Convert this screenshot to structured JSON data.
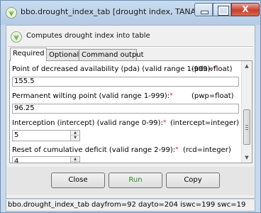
{
  "window": {
    "title": "bbo.drought_index_tab [drought index, TANA...",
    "close_glyph": "X"
  },
  "description": "Computes drought index into table",
  "tabs": [
    {
      "label": "Required",
      "active": true
    },
    {
      "label": "Optional",
      "active": false
    },
    {
      "label": "Command output",
      "active": false
    }
  ],
  "fields": {
    "pda": {
      "label": "Point of decreased availability (pda) (valid range 1-999):",
      "required_mark": "*",
      "type": "(pda=float)",
      "value": "155.5"
    },
    "pwp": {
      "label": "Permanent wilting point (valid range 1-999):",
      "required_mark": "*",
      "type": "(pwp=float)",
      "value": "96.25"
    },
    "intercept": {
      "label": "Interception (intercept) (valid range 0-99):",
      "required_mark": "*",
      "type": "(intercept=integer)",
      "value": "5"
    },
    "rcd": {
      "label": "Reset of cumulative deficit (valid range 2-99):",
      "required_mark": "*",
      "type": "(rcd=integer)",
      "value": "4"
    }
  },
  "buttons": {
    "close": "Close",
    "run": "Run",
    "copy": "Copy"
  },
  "statusbar": "bbo.drought_index_tab dayfrom=92 dayto=204 iswc=199 swc=19",
  "colors": {
    "required_mark": "#e02020",
    "run_text": "#2e8b2e",
    "title_bar": "#b4cbe4",
    "close_button": "#c7402f"
  }
}
